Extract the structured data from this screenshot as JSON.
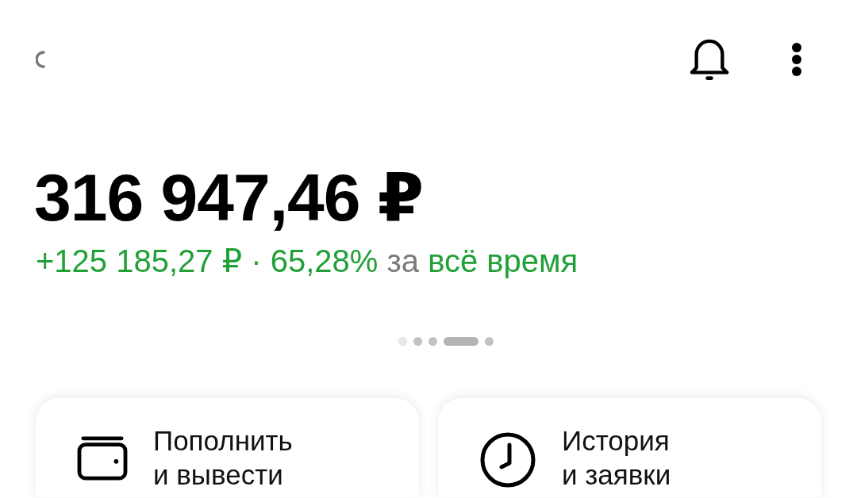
{
  "balance": {
    "amount": "316 947,46 ₽"
  },
  "change": {
    "text": "+125 185,27 ₽ · 65,28%",
    "connector": "за",
    "period": "всё время"
  },
  "pager": [
    {
      "selected": false,
      "faded": true
    },
    {
      "selected": false,
      "faded": false
    },
    {
      "selected": false,
      "faded": false
    },
    {
      "selected": true,
      "faded": false
    },
    {
      "selected": false,
      "faded": false
    }
  ],
  "actions": [
    {
      "kind": "wallet",
      "label": "Пополнить\nи вывести"
    },
    {
      "kind": "clock",
      "label": "История\nи заявки"
    }
  ]
}
